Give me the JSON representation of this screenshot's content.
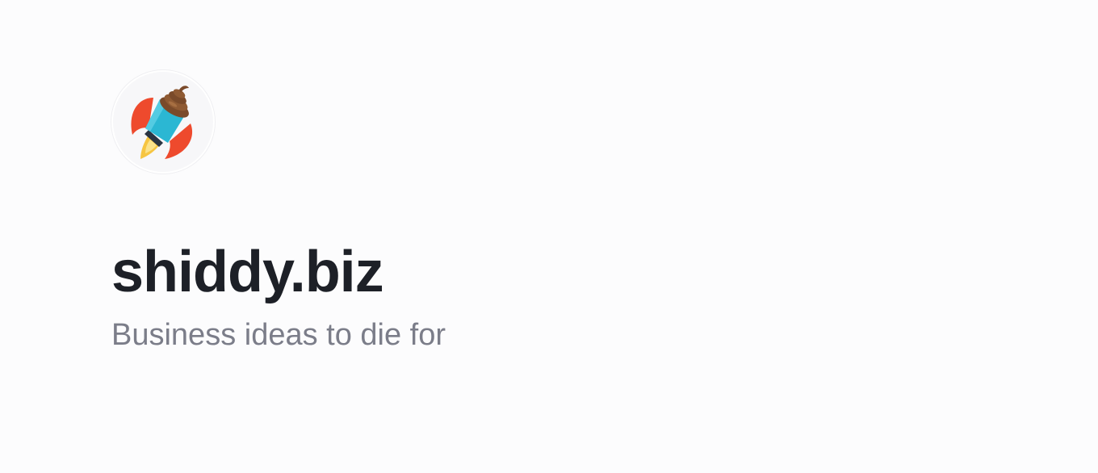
{
  "site": {
    "title": "shiddy.biz",
    "tagline": "Business ideas to die for"
  },
  "logo": {
    "icon": "rocket-poop-icon"
  },
  "colors": {
    "background": "#fcfcfd",
    "title": "#1d2027",
    "tagline": "#7b7d89"
  }
}
